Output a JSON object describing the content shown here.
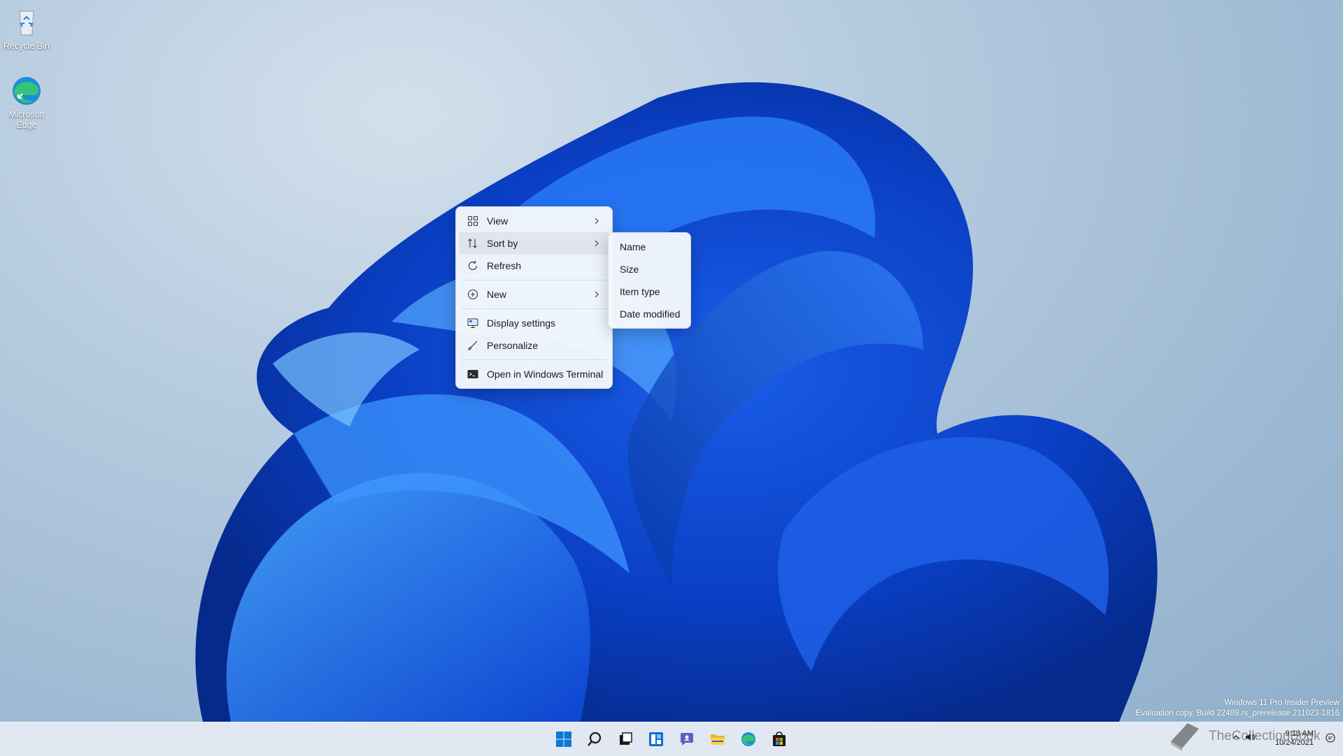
{
  "desktop": {
    "icons": [
      {
        "label": "Recycle Bin"
      },
      {
        "label": "Microsoft Edge"
      }
    ]
  },
  "context_menu": {
    "items": [
      {
        "label": "View",
        "icon": "grid-view-icon",
        "submenu": true
      },
      {
        "label": "Sort by",
        "icon": "sort-icon",
        "submenu": true,
        "highlighted": true
      },
      {
        "label": "Refresh",
        "icon": "refresh-icon",
        "submenu": false
      },
      {
        "label": "New",
        "icon": "plus-circle-icon",
        "submenu": true
      },
      {
        "label": "Display settings",
        "icon": "display-icon",
        "submenu": false
      },
      {
        "label": "Personalize",
        "icon": "brush-icon",
        "submenu": false
      },
      {
        "label": "Open in Windows Terminal",
        "icon": "terminal-icon",
        "submenu": false
      }
    ]
  },
  "sort_submenu": {
    "items": [
      {
        "label": "Name"
      },
      {
        "label": "Size"
      },
      {
        "label": "Item type"
      },
      {
        "label": "Date modified"
      }
    ]
  },
  "watermark": {
    "line1": "Windows 11 Pro Insider Preview",
    "line2": "Evaluation copy. Build 22489.rs_prerelease.211023-1816"
  },
  "taskbar": {
    "apps": [
      "start-icon",
      "search-icon",
      "task-view-icon",
      "widgets-icon",
      "chat-icon",
      "file-explorer-icon",
      "edge-icon",
      "store-icon"
    ],
    "clock": {
      "time": "9:13 AM",
      "date": "10/24/2021"
    }
  },
  "overlay": {
    "logo_text": "TheCollectionBook"
  },
  "colors": {
    "accent": "#0a5ce0",
    "menu_bg": "#f6f9fc",
    "taskbar_bg": "#e6ecf3"
  }
}
